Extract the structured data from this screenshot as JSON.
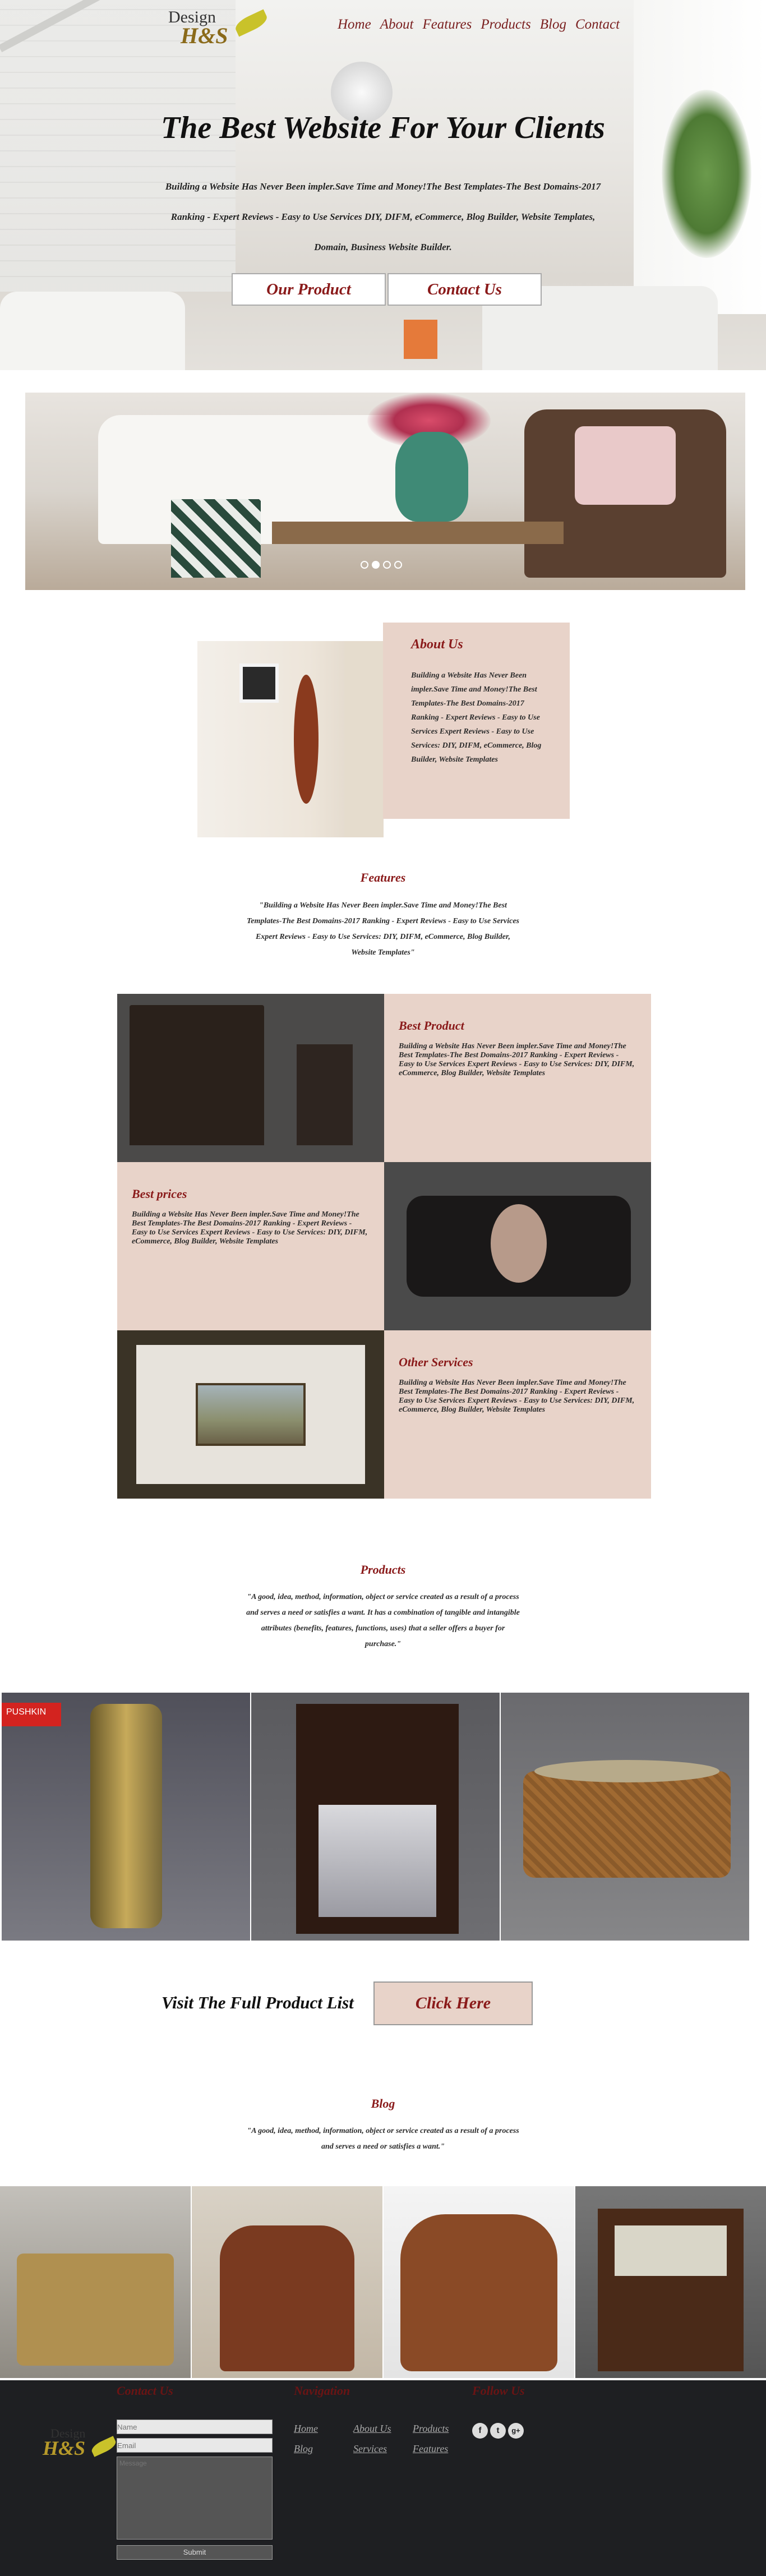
{
  "brand": {
    "line1": "Design",
    "line2": "H&S"
  },
  "nav": [
    "Home",
    "About",
    "Features",
    "Products",
    "Blog",
    "Contact"
  ],
  "hero": {
    "title": "The Best Website For Your Clients",
    "subtitle": "Building a Website Has Never Been impler.Save Time and Money!The Best Templates-The Best Domains-2017 Ranking - Expert Reviews - Easy to Use Services DIY, DIFM, eCommerce, Blog Builder, Website Templates, Domain, Business Website Builder.",
    "btn_product": "Our Product",
    "btn_contact": "Contact Us"
  },
  "slider": {
    "dots": 4,
    "active": 1
  },
  "about": {
    "title": "About Us",
    "text": "Building a Website Has Never Been impler.Save Time and Money!The Best Templates-The Best Domains-2017 Ranking - Expert Reviews - Easy to Use Services Expert Reviews - Easy to Use Services: DIY, DIFM, eCommerce, Blog Builder, Website Templates"
  },
  "features": {
    "title": "Features",
    "quote": "\"Building a Website Has Never Been impler.Save Time and Money!The Best Templates-The Best Domains-2017 Ranking - Expert Reviews - Easy to Use Services Expert Reviews - Easy to Use Services: DIY, DIFM, eCommerce, Blog Builder, Website Templates\"",
    "items": [
      {
        "title": "Best Product",
        "text": "Building a Website Has Never Been impler.Save Time and Money!The Best Templates-The Best Domains-2017 Ranking - Expert Reviews - Easy to Use Services Expert Reviews - Easy to Use Services: DIY, DIFM, eCommerce, Blog Builder, Website Templates"
      },
      {
        "title": "Best prices",
        "text": "Building a Website Has Never Been impler.Save Time and Money!The Best Templates-The Best Domains-2017 Ranking - Expert Reviews - Easy to Use Services Expert Reviews - Easy to Use Services: DIY, DIFM, eCommerce, Blog Builder, Website Templates"
      },
      {
        "title": "Other Services",
        "text": "Building a Website Has Never Been impler.Save Time and Money!The Best Templates-The Best Domains-2017 Ranking - Expert Reviews - Easy to Use Services Expert Reviews - Easy to Use Services: DIY, DIFM, eCommerce, Blog Builder, Website Templates"
      }
    ]
  },
  "products": {
    "title": "Products",
    "quote": "\"A good, idea, method, information, object or service created as a result of a process and serves a need or satisfies a want. It has a combination of tangible and intangible attributes (benefits, features, functions, uses) that a seller offers a buyer for purchase.\"",
    "badge": "PUSHKIN",
    "cta_label": "Visit The Full Product List",
    "cta_button": "Click Here"
  },
  "blog": {
    "title": "Blog",
    "quote": "\"A good, idea, method, information, object or service created as a result of a process and serves a need or satisfies a want.\""
  },
  "footer": {
    "contact_title": "Contact Us",
    "nav_title": "Navigation",
    "follow_title": "Follow Us",
    "name_placeholder": "Name",
    "email_placeholder": "Email",
    "message_placeholder": "Message",
    "submit": "Submit",
    "links_col1": [
      "Home",
      "Blog"
    ],
    "links_col2": [
      "About Us",
      "Services"
    ],
    "links_col3": [
      "Products",
      "Features"
    ],
    "social": [
      "f",
      "t",
      "g+"
    ]
  },
  "colors": {
    "accent": "#8a1a1a",
    "panel": "#e8d3c9",
    "footer": "#1e1f22"
  }
}
